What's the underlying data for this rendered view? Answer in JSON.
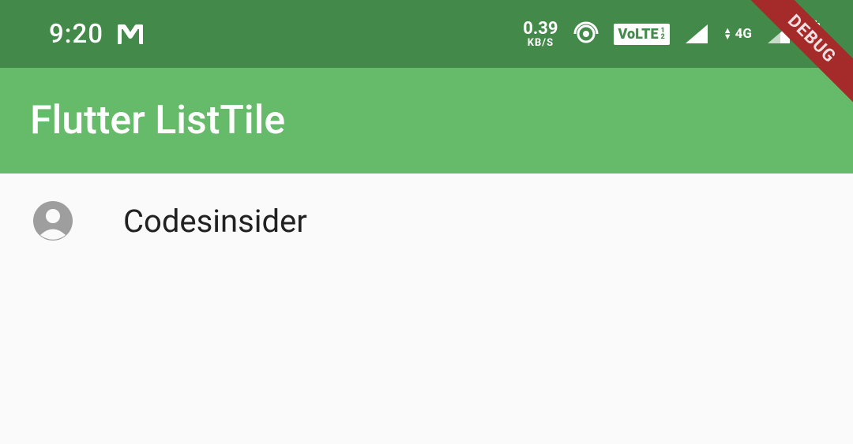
{
  "status_bar": {
    "time": "9:20",
    "speed": {
      "value": "0.39",
      "unit": "KB/S"
    },
    "volte_label": "VoLTE",
    "volte_sub1": "1",
    "volte_sub2": "2",
    "network_label": "4G"
  },
  "app_bar": {
    "title": "Flutter ListTile"
  },
  "list": {
    "items": [
      {
        "title": "Codesinsider"
      }
    ]
  },
  "debug_banner": "DEBUG"
}
